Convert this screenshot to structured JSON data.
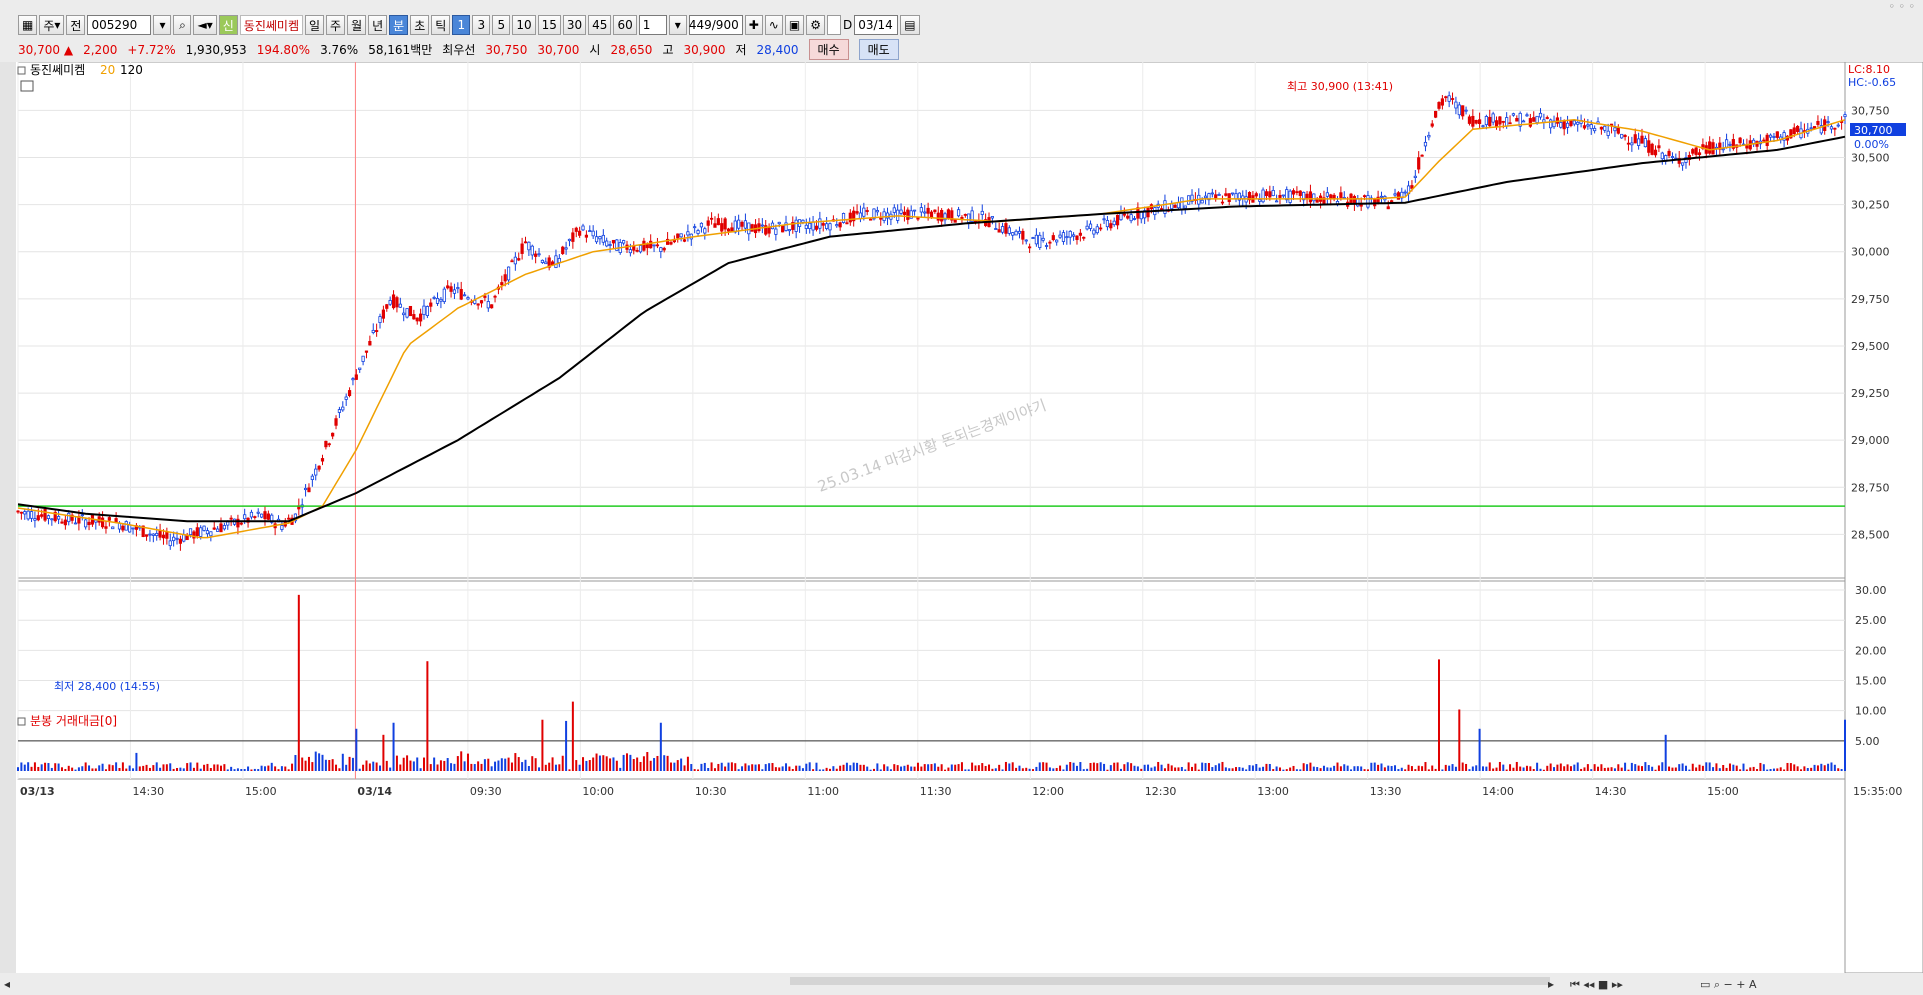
{
  "toolbar": {
    "market": "주",
    "all": "전",
    "code": "005290",
    "badge": "신",
    "name": "동진쎄미켐",
    "periods": [
      "일",
      "주",
      "월",
      "년",
      "분",
      "초",
      "틱"
    ],
    "active_period": "분",
    "intervals": [
      "1",
      "3",
      "5",
      "10",
      "15",
      "30",
      "45",
      "60"
    ],
    "active_interval": "1",
    "step": "1",
    "count": "449",
    "count_total": "/900",
    "d_label": "D",
    "date": "03/14"
  },
  "quote": {
    "price": "30,700",
    "arrow": "▲",
    "change": "2,200",
    "change_pct": "+7.72%",
    "volume": "1,930,953",
    "volume_pct": "194.80%",
    "turnover_pct": "3.76%",
    "amount": "58,161백만",
    "best_label": "최우선",
    "best_ask": "30,750",
    "best_bid": "30,700",
    "open_label": "시",
    "open": "28,650",
    "high_label": "고",
    "high": "30,900",
    "low_label": "저",
    "low": "28,400",
    "buy_button": "매수",
    "sell_button": "매도"
  },
  "legend": {
    "name": "동진쎄미켐",
    "ma20": "20",
    "ma120": "120",
    "volume_title": "분봉 거래대금[0]"
  },
  "annotations": {
    "high": "최고 30,900 (13:41)",
    "low": "최저 28,400 (14:55)",
    "watermark": "25.03.14 마감시황 돈되는경제이야기",
    "lc": "LC:8.10",
    "hc": "HC:-0.65",
    "current_price": "30,700",
    "current_pct": "0.00%",
    "end_time": "15:35:00"
  },
  "colors": {
    "up": "#e00000",
    "down": "#1040e0",
    "ma20": "#f0a000",
    "ma120": "#000000",
    "prev_close": "#22cc22"
  },
  "chart_data": {
    "type": "candlestick",
    "price_axis": {
      "ticks": [
        "30,750",
        "30,500",
        "30,250",
        "30,000",
        "29,750",
        "29,500",
        "29,250",
        "29,000",
        "28,750",
        "28,500"
      ],
      "range": [
        28290,
        30980
      ]
    },
    "volume_axis": {
      "ticks": [
        "30.00",
        "25.00",
        "20.00",
        "15.00",
        "10.00",
        "5.00"
      ],
      "range": [
        0,
        31
      ]
    },
    "time_labels": [
      "03/13",
      "14:30",
      "15:00",
      "03/14",
      "09:30",
      "10:00",
      "10:30",
      "11:00",
      "11:30",
      "12:00",
      "12:30",
      "13:00",
      "13:30",
      "14:00",
      "14:30",
      "15:00",
      "15:35:00"
    ],
    "session_split": "03/14",
    "prev_close": 28650,
    "volume_threshold": 5.0,
    "price_path": [
      [
        0,
        28620
      ],
      [
        15,
        28580
      ],
      [
        30,
        28560
      ],
      [
        45,
        28470
      ],
      [
        60,
        28540
      ],
      [
        72,
        28600
      ],
      [
        78,
        28550
      ],
      [
        82,
        28600
      ],
      [
        90,
        28920
      ],
      [
        100,
        29350
      ],
      [
        110,
        29750
      ],
      [
        118,
        29650
      ],
      [
        128,
        29800
      ],
      [
        140,
        29720
      ],
      [
        150,
        30050
      ],
      [
        158,
        29920
      ],
      [
        166,
        30120
      ],
      [
        176,
        30030
      ],
      [
        190,
        30020
      ],
      [
        205,
        30150
      ],
      [
        220,
        30120
      ],
      [
        240,
        30150
      ],
      [
        250,
        30200
      ],
      [
        270,
        30200
      ],
      [
        285,
        30180
      ],
      [
        300,
        30050
      ],
      [
        315,
        30100
      ],
      [
        330,
        30200
      ],
      [
        350,
        30280
      ],
      [
        370,
        30300
      ],
      [
        390,
        30280
      ],
      [
        405,
        30260
      ],
      [
        412,
        30350
      ],
      [
        418,
        30700
      ],
      [
        422,
        30820
      ],
      [
        430,
        30700
      ],
      [
        450,
        30700
      ],
      [
        470,
        30650
      ],
      [
        480,
        30580
      ],
      [
        490,
        30480
      ],
      [
        500,
        30550
      ],
      [
        515,
        30580
      ],
      [
        530,
        30650
      ],
      [
        540,
        30700
      ]
    ],
    "ma20_path": [
      [
        0,
        28640
      ],
      [
        30,
        28560
      ],
      [
        55,
        28480
      ],
      [
        80,
        28560
      ],
      [
        90,
        28650
      ],
      [
        100,
        28950
      ],
      [
        115,
        29500
      ],
      [
        130,
        29700
      ],
      [
        150,
        29880
      ],
      [
        170,
        30000
      ],
      [
        200,
        30080
      ],
      [
        230,
        30150
      ],
      [
        260,
        30190
      ],
      [
        290,
        30160
      ],
      [
        320,
        30200
      ],
      [
        350,
        30280
      ],
      [
        400,
        30280
      ],
      [
        410,
        30290
      ],
      [
        420,
        30480
      ],
      [
        430,
        30650
      ],
      [
        460,
        30700
      ],
      [
        480,
        30640
      ],
      [
        500,
        30540
      ],
      [
        520,
        30590
      ],
      [
        540,
        30700
      ]
    ],
    "ma120_path": [
      [
        0,
        28660
      ],
      [
        20,
        28610
      ],
      [
        50,
        28570
      ],
      [
        80,
        28570
      ],
      [
        100,
        28720
      ],
      [
        130,
        29000
      ],
      [
        160,
        29330
      ],
      [
        185,
        29680
      ],
      [
        210,
        29940
      ],
      [
        240,
        30080
      ],
      [
        280,
        30150
      ],
      [
        320,
        30200
      ],
      [
        360,
        30240
      ],
      [
        410,
        30260
      ],
      [
        440,
        30370
      ],
      [
        480,
        30470
      ],
      [
        520,
        30540
      ],
      [
        540,
        30610
      ]
    ],
    "volume_spikes": [
      [
        83,
        29.2
      ],
      [
        121,
        18.2
      ],
      [
        164,
        11.5
      ],
      [
        420,
        18.5
      ],
      [
        426,
        10.2
      ],
      [
        162,
        8.3
      ],
      [
        111,
        8.0
      ],
      [
        155,
        8.5
      ],
      [
        190,
        8.0
      ],
      [
        100,
        7.0
      ],
      [
        108,
        6.0
      ],
      [
        432,
        7.0
      ],
      [
        487,
        6.0
      ],
      [
        540,
        8.5
      ],
      [
        35,
        3.0
      ]
    ]
  }
}
